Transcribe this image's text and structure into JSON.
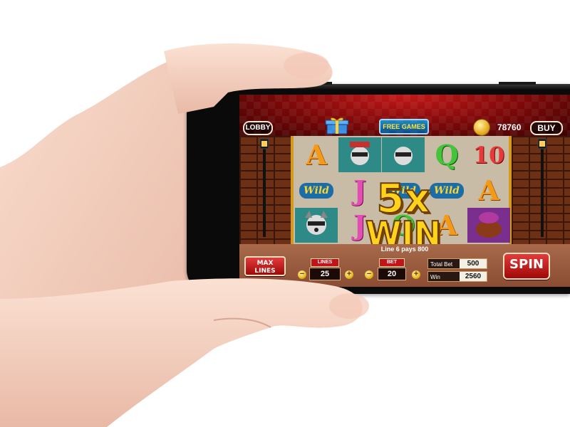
{
  "colors": {
    "skin": "#f5cfc0",
    "top_bar_red": "#7a0808",
    "bottom_bar_brown": "#8a4d33",
    "spin_red": "#c41818",
    "win_gold": "#ffd21c",
    "free_games_blue": "#0b4b86"
  },
  "top_bar": {
    "lobby_label": "LOBBY",
    "free_games_label": "FREE GAMES",
    "gift_icon": "gift-box-icon",
    "coin_icon": "gold-coin-icon",
    "coins": "78760",
    "buy_label": "BUY"
  },
  "reels": {
    "columns": [
      [
        "A",
        "wild",
        "character"
      ],
      [
        "character",
        "J",
        "J"
      ],
      [
        "character",
        "wild",
        "Q"
      ],
      [
        "Q",
        "wild",
        "A"
      ],
      [
        "10",
        "A",
        "character"
      ]
    ]
  },
  "win_banner": {
    "multiplier": "5x",
    "word": "WIN"
  },
  "bottom_bar": {
    "pays_text": "Line 6 pays 800",
    "max_lines_label_1": "MAX",
    "max_lines_label_2": "LINES",
    "lines_label": "LINES",
    "lines_value": "25",
    "bet_label": "BET",
    "bet_value": "20",
    "plus_icon": "plus-icon",
    "minus_icon": "minus-icon",
    "total_bet_label": "Total Bet",
    "total_bet_value": "500",
    "win_label": "Win",
    "win_value": "2560",
    "spin_label": "SPIN"
  }
}
